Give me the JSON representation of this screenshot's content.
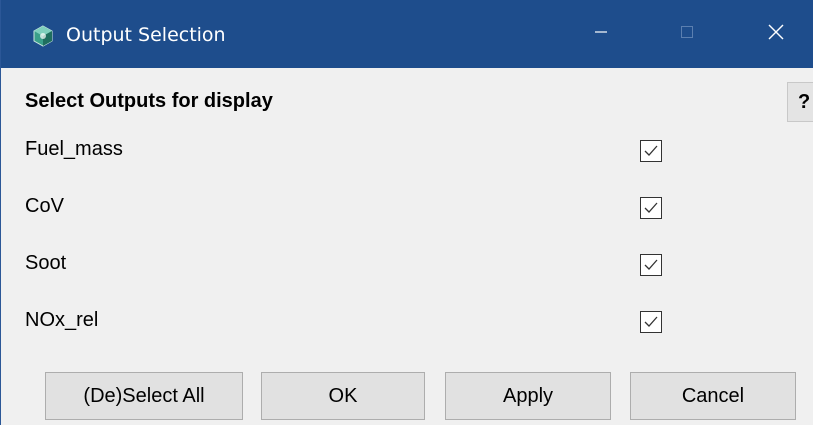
{
  "window": {
    "title": "Output Selection",
    "app_icon": "cube-app-icon",
    "controls": {
      "minimize_icon": "minimize-icon",
      "maximize_icon": "maximize-icon",
      "close_icon": "close-icon"
    }
  },
  "header": {
    "label": "Select Outputs for display",
    "help_label": "?"
  },
  "outputs": [
    {
      "label": "Fuel_mass",
      "checked": true
    },
    {
      "label": "CoV",
      "checked": true
    },
    {
      "label": "Soot",
      "checked": true
    },
    {
      "label": "NOx_rel",
      "checked": true
    }
  ],
  "buttons": {
    "deselect_all": "(De)Select All",
    "ok": "OK",
    "apply": "Apply",
    "cancel": "Cancel"
  },
  "colors": {
    "titlebar": "#1e4d8c",
    "background": "#f0f0f0",
    "button": "#e1e1e1"
  }
}
